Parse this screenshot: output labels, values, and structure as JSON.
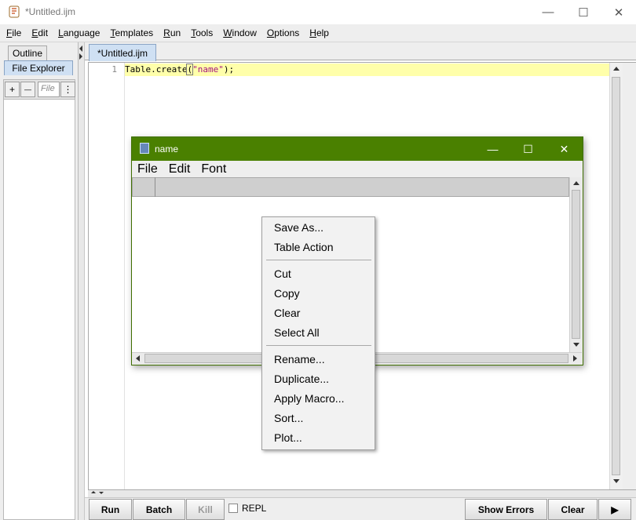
{
  "window": {
    "title": "*Untitled.ijm",
    "minimize_glyph": "—",
    "maximize_glyph": "☐",
    "close_glyph": "✕"
  },
  "menubar": {
    "items": [
      {
        "mnemonic": "F",
        "rest": "ile"
      },
      {
        "mnemonic": "E",
        "rest": "dit"
      },
      {
        "mnemonic": "L",
        "rest": "anguage"
      },
      {
        "mnemonic": "T",
        "rest": "emplates"
      },
      {
        "mnemonic": "R",
        "rest": "un"
      },
      {
        "mnemonic": "T",
        "rest": "ools"
      },
      {
        "mnemonic": "W",
        "rest": "indow"
      },
      {
        "mnemonic": "O",
        "rest": "ptions"
      },
      {
        "mnemonic": "H",
        "rest": "elp"
      }
    ]
  },
  "left_panel": {
    "tabs": [
      "Outline",
      "File Explorer"
    ],
    "add_label": "+",
    "remove_label": "—",
    "filter_placeholder": "File",
    "more_label": "⋮"
  },
  "editor": {
    "tab_label": "*Untitled.ijm",
    "line_number": "1",
    "code_prefix": "Table.create",
    "code_open": "(",
    "code_string": "\"name\"",
    "code_suffix": ");"
  },
  "bottom_bar": {
    "run_label": "Run",
    "batch_label": "Batch",
    "kill_label": "Kill",
    "repl_label": "REPL",
    "show_errors_label": "Show Errors",
    "clear_label": "Clear",
    "next_glyph": "▶"
  },
  "table_window": {
    "title": "name",
    "minimize_glyph": "—",
    "maximize_glyph": "☐",
    "close_glyph": "✕",
    "menus": [
      "File",
      "Edit",
      "Font"
    ]
  },
  "context_menu": {
    "group1": [
      "Save As...",
      "Table Action"
    ],
    "group2": [
      "Cut",
      "Copy",
      "Clear",
      "Select All"
    ],
    "group3": [
      "Rename...",
      "Duplicate...",
      "Apply Macro...",
      "Sort...",
      "Plot..."
    ]
  },
  "colors": {
    "table_title_bar": "#4a8000",
    "current_line_highlight": "#ffffaa",
    "string_literal": "#a4137f",
    "editor_tab_active": "#cfe0f3"
  }
}
